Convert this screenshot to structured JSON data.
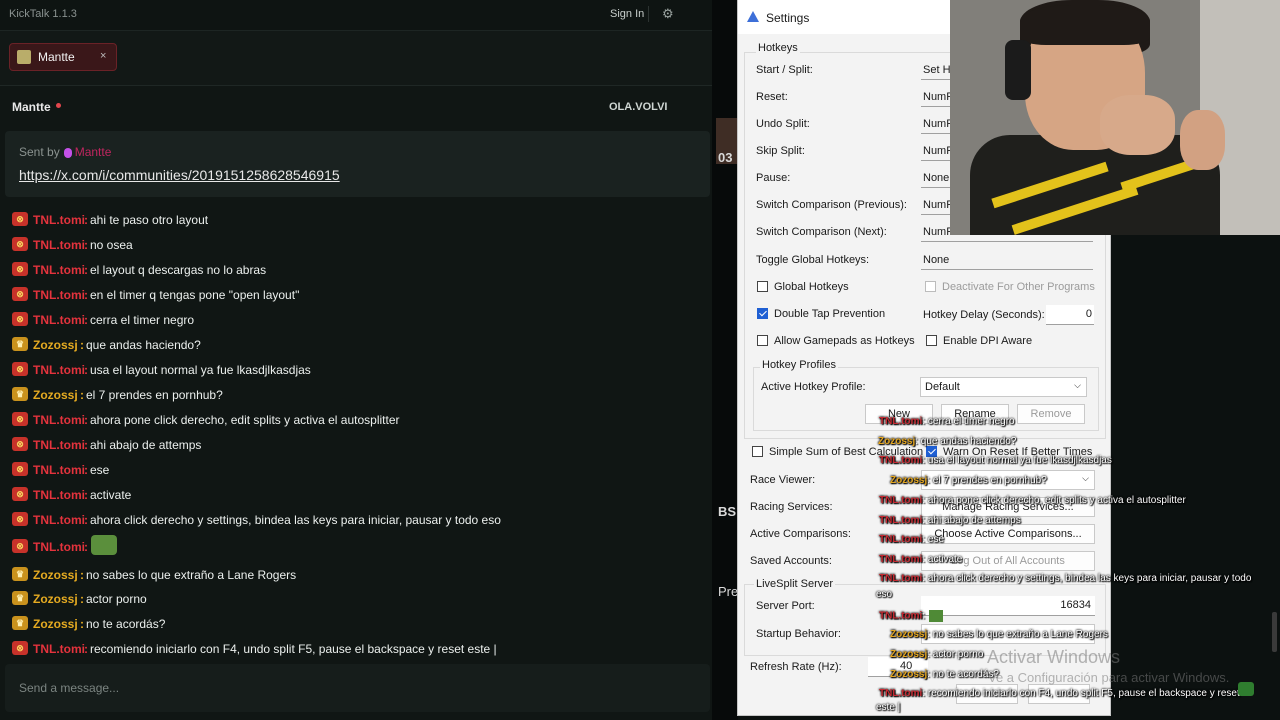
{
  "kicktalk": {
    "app_title": "KickTalk 1.1.3",
    "sign_in": "Sign In",
    "tab": {
      "label": "Mantte",
      "close": "×"
    },
    "channel": {
      "name": "Mantte",
      "right_label": "OLA.VOLVI"
    },
    "pinned": {
      "sent_by": "Sent by",
      "user": "Mantte",
      "link": "https://x.com/i/communities/2019151258628546915"
    },
    "messages": [
      {
        "user": "TNL.tomi",
        "text": "ahi te paso otro layout",
        "type": "tnl"
      },
      {
        "user": "TNL.tomi",
        "text": "no osea",
        "type": "tnl"
      },
      {
        "user": "TNL.tomi",
        "text": "el layout q descargas no lo abras",
        "type": "tnl"
      },
      {
        "user": "TNL.tomi",
        "text": "en el timer q tengas pone \"open layout\"",
        "type": "tnl"
      },
      {
        "user": "TNL.tomi",
        "text": "cerra el timer negro",
        "type": "tnl"
      },
      {
        "user": "Zozossj",
        "text": "que andas haciendo?",
        "type": "zoz"
      },
      {
        "user": "TNL.tomi",
        "text": "usa el layout normal ya fue lkasdjlkasdjas",
        "type": "tnl"
      },
      {
        "user": "Zozossj",
        "text": "el 7 prendes en pornhub?",
        "type": "zoz"
      },
      {
        "user": "TNL.tomi",
        "text": "ahora pone click derecho, edit splits y activa el autosplitter",
        "type": "tnl"
      },
      {
        "user": "TNL.tomi",
        "text": "ahi abajo de attemps",
        "type": "tnl"
      },
      {
        "user": "TNL.tomi",
        "text": "ese",
        "type": "tnl"
      },
      {
        "user": "TNL.tomi",
        "text": "activate",
        "type": "tnl"
      },
      {
        "user": "TNL.tomi",
        "text": "ahora click derecho y settings, bindea las keys para iniciar, pausar y todo eso",
        "type": "tnl"
      },
      {
        "user": "TNL.tomi",
        "text": "",
        "type": "tnl",
        "emote": true
      },
      {
        "user": "Zozossj",
        "text": "no sabes lo que extraño a Lane Rogers",
        "type": "zoz"
      },
      {
        "user": "Zozossj",
        "text": "actor porno",
        "type": "zoz"
      },
      {
        "user": "Zozossj",
        "text": "no te acordás?",
        "type": "zoz"
      },
      {
        "user": "TNL.tomi",
        "text": "recomiendo iniciarlo con F4, undo split F5, pause el backspace y reset este |",
        "type": "tnl"
      }
    ],
    "input_placeholder": "Send a message...",
    "middle": {
      "t1": "03",
      "t2": "BS",
      "t3": "Pre"
    }
  },
  "settings": {
    "title": "Settings",
    "hotkeys_group": "Hotkeys",
    "rows": [
      {
        "label": "Start / Split:",
        "value": "Set Ho"
      },
      {
        "label": "Reset:",
        "value": "NumP"
      },
      {
        "label": "Undo Split:",
        "value": "NumP"
      },
      {
        "label": "Skip Split:",
        "value": "NumP"
      },
      {
        "label": "Pause:",
        "value": "None"
      },
      {
        "label": "Switch Comparison (Previous):",
        "value": "NumP"
      },
      {
        "label": "Switch Comparison (Next):",
        "value": "NumPad"
      },
      {
        "label": "Toggle Global Hotkeys:",
        "value": "None"
      }
    ],
    "global_hotkeys": "Global Hotkeys",
    "deactivate": "Deactivate For Other Programs",
    "double_tap": "Double Tap Prevention",
    "hotkey_delay_label": "Hotkey Delay (Seconds):",
    "hotkey_delay_value": "0",
    "allow_gamepads": "Allow Gamepads as Hotkeys",
    "enable_dpi": "Enable DPI Aware",
    "profiles_group": "Hotkey Profiles",
    "active_profile_label": "Active Hotkey Profile:",
    "active_profile_value": "Default",
    "btn_new": "New",
    "btn_rename": "Rename",
    "btn_remove": "Remove",
    "simple_sum": "Simple Sum of Best Calculation",
    "warn_reset": "Warn On Reset If Better Times",
    "race_viewer": "Race Viewer:",
    "racing_services": "Racing Services:",
    "manage_racing": "Manage Racing Services...",
    "active_comparisons": "Active Comparisons:",
    "choose_comparisons": "Choose Active Comparisons...",
    "saved_accounts": "Saved Accounts:",
    "log_out": "Log Out of All Accounts",
    "livesplit_server": "LiveSplit Server",
    "server_port_label": "Server Port:",
    "server_port_value": "16834",
    "startup_behavior": "Startup Behavior:",
    "refresh_rate": "Refresh Rate (Hz):",
    "refresh_value": "40"
  },
  "overlay": {
    "lines": [
      {
        "u": "TNL.tomi",
        "t": ": cerra el timer negro",
        "k": "on"
      },
      {
        "u": "Zozossj",
        "t": ": que andas haciendo?",
        "k": "oz"
      },
      {
        "u": "TNL.tomi",
        "t": ": usa el layout normal ya fue lkasdjlkasdjas",
        "k": "on"
      },
      {
        "u": "Zozossj",
        "t": ": el 7 prendes en pornhub?",
        "k": "oz"
      },
      {
        "u": "TNL.tomi",
        "t": ": ahora pone click derecho, edit splits y activa el autosplitter",
        "k": "on"
      },
      {
        "u": "TNL.tomi",
        "t": ": ahi abajo de attemps",
        "k": "on"
      },
      {
        "u": "TNL.tomi",
        "t": ": ese",
        "k": "on"
      },
      {
        "u": "TNL.tomi",
        "t": ": activate",
        "k": "on"
      },
      {
        "u": "TNL.tomi",
        "t": ": ahora click derecho y settings, bindea las keys para iniciar, pausar y todo",
        "k": "on"
      },
      {
        "u": "",
        "t": "eso",
        "k": "on"
      },
      {
        "u": "TNL.tomi",
        "t": ":",
        "k": "on",
        "emote": true
      },
      {
        "u": "Zozossj",
        "t": ": no sabes lo que extraño a Lane Rogers",
        "k": "oz"
      },
      {
        "u": "Zozossj",
        "t": ": actor porno",
        "k": "oz"
      },
      {
        "u": "Zozossj",
        "t": ": no te acordás?",
        "k": "oz"
      },
      {
        "u": "TNL.tomi",
        "t": ": recomiendo iniciarlo con F4, undo split F5, pause el backspace y reset",
        "k": "on"
      },
      {
        "u": "",
        "t": "este |",
        "k": "on"
      }
    ]
  },
  "watermark": {
    "line1": "Activar Windows",
    "line2": "Ve a Configuración para activar Windows."
  }
}
